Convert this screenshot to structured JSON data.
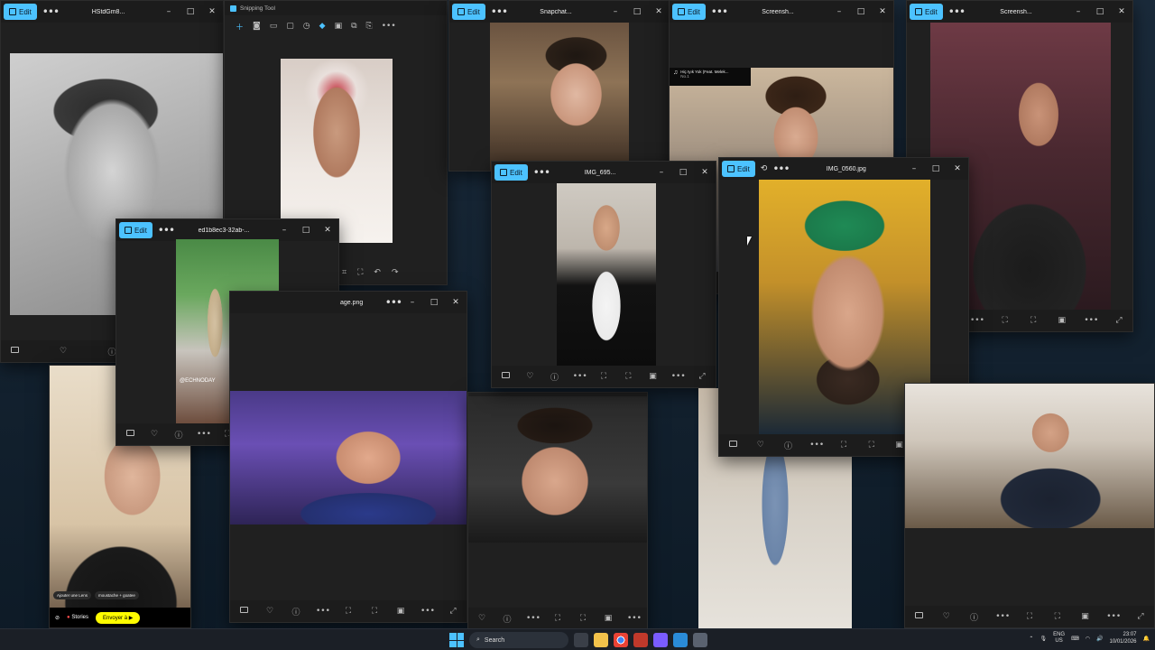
{
  "windows": [
    {
      "title": "HStdGm8...",
      "controls": [
        "–",
        "□",
        "✕"
      ]
    },
    {
      "title": "Snipping Tool"
    },
    {
      "title": "Snapchat...",
      "controls": [
        "–",
        "□",
        "✕"
      ]
    },
    {
      "title": "Screensh...",
      "controls": [
        "–",
        "□",
        "✕"
      ]
    },
    {
      "title": "Screensh...",
      "controls": [
        "–",
        "□",
        "✕"
      ]
    },
    {
      "title": "ed1b8ec3-32ab-...",
      "controls": [
        "–",
        "□",
        "✕"
      ]
    },
    {
      "title": "IMG_695...",
      "controls": [
        "–",
        "□",
        "✕"
      ]
    },
    {
      "title": "IMG_0560.jpg",
      "controls": [
        "–",
        "□",
        "✕"
      ]
    },
    {
      "title": "age.png",
      "controls": [
        "–",
        "□",
        "✕"
      ]
    }
  ],
  "edit_label": "Edit",
  "music_overlay": {
    "line1": "Hiç Iyık Yok (Feat. Melek...",
    "line2": "No.1"
  },
  "snap_ui": {
    "lens_chip": "Ajouter une Lens",
    "filter_chip": "moustache + goatee",
    "stories": "Stories",
    "send": "Envoyer à"
  },
  "watermark": "@ECHNODAY",
  "taskbar": {
    "search": "Search",
    "lang_top": "ENG",
    "lang_bottom": "US",
    "time": "23:07",
    "date": "10/01/2026"
  },
  "colors": {
    "accent": "#4cc2ff",
    "snap_yellow": "#fffc00"
  }
}
